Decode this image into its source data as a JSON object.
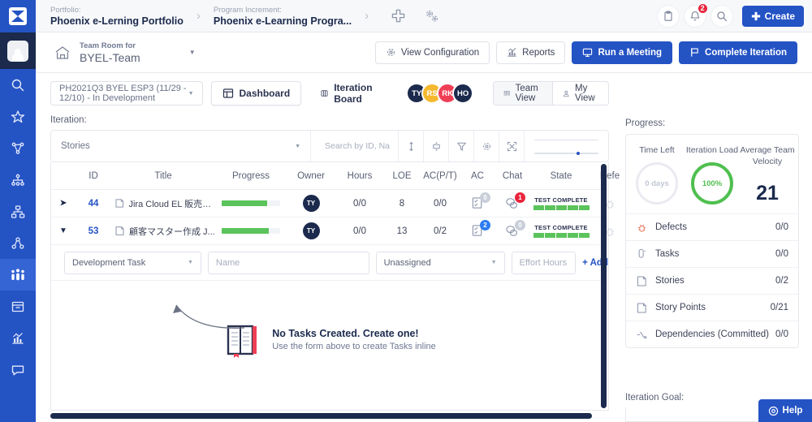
{
  "topbar": {
    "breadcrumbs": [
      {
        "label": "Portfolio:",
        "value": "Phoenix e-Lerning Portfolio"
      },
      {
        "label": "Program Increment:",
        "value": "Phoenix e-Learning Progra..."
      }
    ],
    "separator": "›",
    "notification_count": "2",
    "create_label": "Create"
  },
  "teamheader": {
    "label": "Team Room for",
    "name": "BYEL-Team",
    "buttons": [
      {
        "label": "View Configuration",
        "icon": "gear-icon",
        "style": "default"
      },
      {
        "label": "Reports",
        "icon": "chart-icon",
        "style": "default"
      },
      {
        "label": "Run a Meeting",
        "icon": "monitor-icon",
        "style": "primary"
      },
      {
        "label": "Complete Iteration",
        "icon": "flag-icon",
        "style": "primary"
      }
    ]
  },
  "iteration_bar": {
    "selected_iteration": "PH2021Q3 BYEL ESP3 (11/29 - 12/10) - In Development",
    "tabs": [
      {
        "label": "Dashboard",
        "icon": "dashboard-icon",
        "selected": true
      },
      {
        "label": "Iteration Board",
        "icon": "board-icon",
        "selected": false
      }
    ],
    "avatars": [
      {
        "initials": "TY",
        "color": "#1b2a4d"
      },
      {
        "initials": "RS",
        "color": "#f5b82e"
      },
      {
        "initials": "RK",
        "color": "#ef3f56"
      },
      {
        "initials": "HO",
        "color": "#1b2a4d"
      }
    ],
    "view_toggle": [
      {
        "label": "Team View",
        "icon": "team-icon",
        "selected": true
      },
      {
        "label": "My View",
        "icon": "person-icon",
        "selected": false
      }
    ]
  },
  "work_panel": {
    "section_label": "Iteration:",
    "filter_type": "Stories",
    "search_placeholder": "Search by ID, Na",
    "toolbar_icons": [
      "sort-icon",
      "expand-rows-icon",
      "filter-icon",
      "settings-icon",
      "fullscreen-icon"
    ],
    "columns": [
      "ID",
      "Title",
      "Progress",
      "Owner",
      "Hours",
      "LOE",
      "AC(P/T)",
      "AC",
      "Chat",
      "State",
      "Defe"
    ],
    "rows": [
      {
        "expanded": false,
        "id": "44",
        "title": "Jira Cloud EL 販売価...",
        "progress_pct": 78,
        "owner": "TY",
        "hours": "0/0",
        "loe": "8",
        "ac_pt": "0/0",
        "ac_count": "0",
        "ac_badge_color": "gray",
        "chat_count": "1",
        "chat_badge_color": "red",
        "state": "TEST COMPLETE",
        "state_segments": 5
      },
      {
        "expanded": true,
        "id": "53",
        "title": "顧客マスター作成 J...",
        "progress_pct": 80,
        "owner": "TY",
        "hours": "0/0",
        "loe": "13",
        "ac_pt": "0/2",
        "ac_count": "2",
        "ac_badge_color": "blue",
        "chat_count": "0",
        "chat_badge_color": "gray",
        "state": "TEST COMPLETE",
        "state_segments": 5
      }
    ],
    "task_form": {
      "type": "Development Task",
      "name_placeholder": "Name",
      "assignee": "Unassigned",
      "effort_placeholder": "Effort Hours",
      "add_label": "+ Add"
    },
    "empty_state": {
      "title": "No Tasks Created. Create one!",
      "subtitle": "Use the form above to create Tasks inline"
    }
  },
  "progress_panel": {
    "label": "Progress:",
    "gauges": [
      {
        "caption": "Time Left",
        "value": "0 days",
        "style": "gray"
      },
      {
        "caption": "Iteration Load",
        "value": "100%",
        "style": "green"
      },
      {
        "caption": "Average Team Velocity",
        "value": "21",
        "style": "number"
      }
    ],
    "stats": [
      {
        "icon": "bug-icon",
        "name": "Defects",
        "value": "0/0"
      },
      {
        "icon": "task-icon",
        "name": "Tasks",
        "value": "0/0"
      },
      {
        "icon": "story-icon",
        "name": "Stories",
        "value": "0/2"
      },
      {
        "icon": "story-icon",
        "name": "Story Points",
        "value": "0/21"
      },
      {
        "icon": "dependency-icon",
        "name": "Dependencies (Committed)",
        "value": "0/0"
      }
    ],
    "goal_label": "Iteration Goal:"
  },
  "help": {
    "label": "Help"
  },
  "sidebar": {
    "items": [
      {
        "icon": "search-icon",
        "active": false
      },
      {
        "icon": "star-icon",
        "active": false
      },
      {
        "icon": "network-icon",
        "active": false
      },
      {
        "icon": "hierarchy-icon",
        "active": false
      },
      {
        "icon": "org-chart-icon",
        "active": false
      },
      {
        "icon": "people-icon",
        "active": false
      },
      {
        "icon": "team-members-icon",
        "active": true
      },
      {
        "icon": "archive-icon",
        "active": false
      },
      {
        "icon": "analytics-icon",
        "active": false
      },
      {
        "icon": "chat-icon",
        "active": false
      }
    ]
  },
  "colors": {
    "brand": "#2453c4",
    "rail": "#2453c4",
    "dark": "#1b2a4d",
    "green": "#5bc35b",
    "red": "#e8253c"
  }
}
